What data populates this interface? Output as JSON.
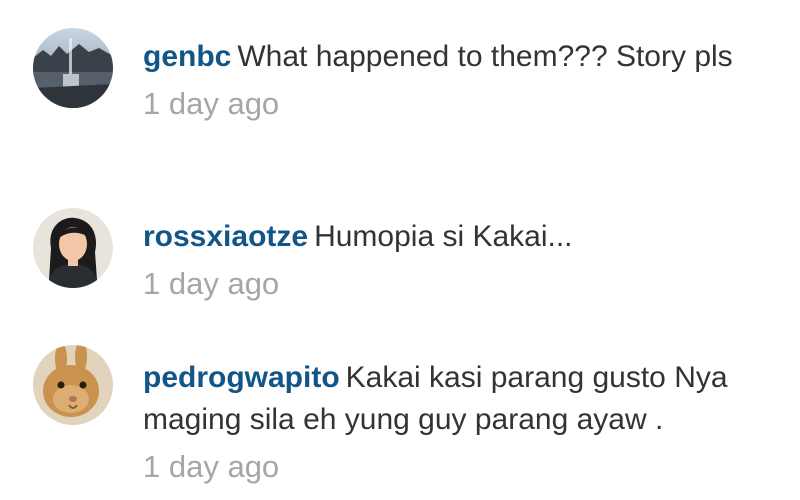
{
  "comments": [
    {
      "username": "genbc",
      "text": "What happened to them??? Story pls",
      "time": "1 day ago",
      "avatar_icon": "lake-photo-avatar"
    },
    {
      "username": "rossxiaotze",
      "text": "Humopia si Kakai...",
      "time": "1 day ago",
      "avatar_icon": "woman-photo-avatar"
    },
    {
      "username": "pedrogwapito",
      "text": "Kakai kasi parang gusto Nya maging sila eh yung guy parang ayaw .",
      "time": "1 day ago",
      "avatar_icon": "rabbit-photo-avatar"
    }
  ],
  "colors": {
    "username": "#125688",
    "comment_text": "#333333",
    "timestamp": "#a6a6a6",
    "background": "#ffffff"
  }
}
